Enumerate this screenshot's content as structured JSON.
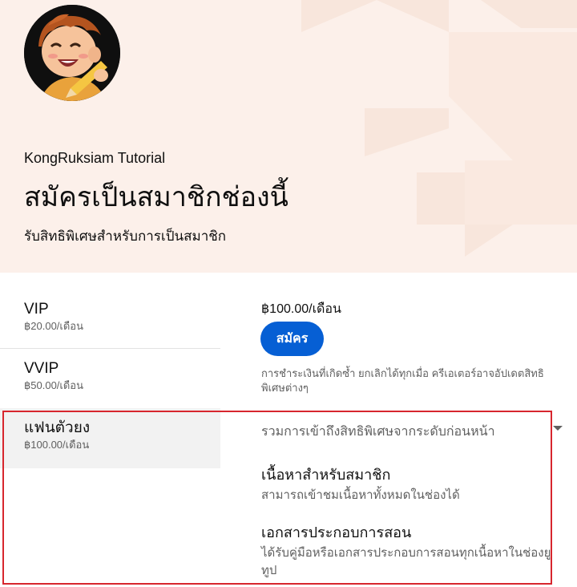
{
  "header": {
    "channel_name": "KongRuksiam Tutorial",
    "title": "สมัครเป็นสมาชิกช่องนี้",
    "subtitle": "รับสิทธิพิเศษสำหรับการเป็นสมาชิก"
  },
  "tiers": [
    {
      "name": "VIP",
      "price": "฿20.00/เดือน"
    },
    {
      "name": "VVIP",
      "price": "฿50.00/เดือน"
    },
    {
      "name": "แฟนตัวยง",
      "price": "฿100.00/เดือน",
      "selected": true
    }
  ],
  "detail": {
    "price": "฿100.00/เดือน",
    "join_label": "สมัคร",
    "note": "การชำระเงินที่เกิดซ้ำ ยกเลิกได้ทุกเมื่อ ครีเอเตอร์อาจอัปเดตสิทธิพิเศษต่างๆ",
    "includes": "รวมการเข้าถึงสิทธิพิเศษจากระดับก่อนหน้า",
    "perks": [
      {
        "title": "เนื้อหาสำหรับสมาชิก",
        "desc": "สามารถเข้าชมเนื้อหาทั้งหมดในช่องได้"
      },
      {
        "title": "เอกสารประกอบการสอน",
        "desc": "ได้รับคู่มือหรือเอกสารประกอบการสอนทุกเนื้อหาในช่องยูทูป"
      }
    ]
  },
  "colors": {
    "hero_background": "#fcf0ea",
    "primary_button": "#065fd4",
    "selected_tier_background": "#f2f2f2",
    "highlight_border": "#d7262e"
  },
  "icons": {
    "avatar": "cartoon-boy-with-pencil",
    "expand": "caret-down-icon"
  }
}
